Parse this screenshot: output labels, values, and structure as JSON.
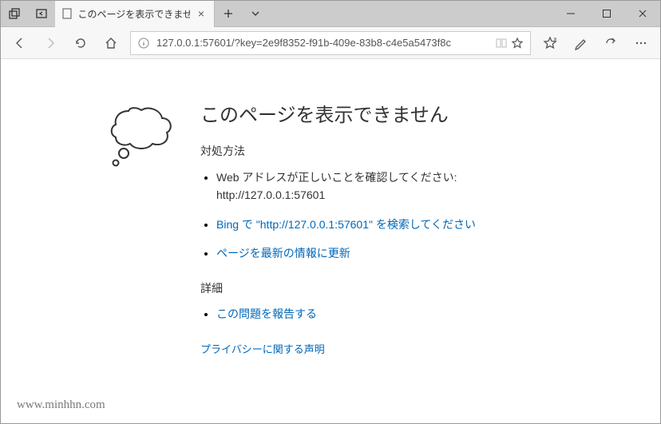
{
  "tab": {
    "title": "このページを表示できません"
  },
  "addressbar": {
    "url": "127.0.0.1:57601/?key=2e9f8352-f91b-409e-83b8-c4e5a5473f8c"
  },
  "error": {
    "title": "このページを表示できません",
    "how_to_label": "対処方法",
    "suggestion_check_address": "Web アドレスが正しいことを確認してください: http://127.0.0.1:57601",
    "suggestion_bing_search": "Bing で \"http://127.0.0.1:57601\" を検索してください",
    "suggestion_refresh": "ページを最新の情報に更新",
    "details_label": "詳細",
    "report_issue": "この問題を報告する",
    "privacy_link": "プライバシーに関する声明"
  },
  "watermark": "www.minhhn.com"
}
